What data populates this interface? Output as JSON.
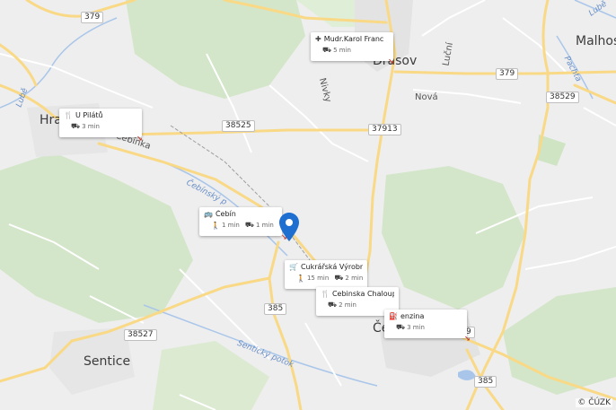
{
  "map": {
    "attribution": "© ČÚZK",
    "places": {
      "dr": "Drásov",
      "hr": "Hra",
      "sentice": "Sentice",
      "malhos": "Malhos",
      "ce": "Če",
      "nivky": "Nivky",
      "lucni": "Luční",
      "nova": "Nová",
      "cebinka": "Čebínka"
    },
    "streams": {
      "cebinsky": "Čebínský p",
      "sentice": "Sentický potok",
      "lube": "Lubě",
      "lube2": "Lubě",
      "pachta": "Pachta"
    },
    "roads": {
      "r379a": "379",
      "r379b": "379",
      "r38525": "38525",
      "r37913": "37913",
      "r38529": "38529",
      "r385a": "385",
      "r385b": "385",
      "r38527": "38527",
      "r9": "9"
    },
    "cards": [
      {
        "title": "Mudr.Karol Franc",
        "icon": "medical-icon",
        "drive": "5 min"
      },
      {
        "title": "U Pilátů",
        "icon": "restaurant-icon",
        "drive": "3 min"
      },
      {
        "title": "Čebín",
        "icon": "bus-icon",
        "walk": "1 min",
        "drive": "1 min"
      },
      {
        "title": "Cukrářská Výrobn...",
        "icon": "shop-icon",
        "walk": "15 min",
        "drive": "2 min"
      },
      {
        "title": "Cebinska Chaloup...",
        "icon": "restaurant-icon",
        "drive": "2 min"
      },
      {
        "title": "enzina",
        "icon": "fuel-icon",
        "drive": "3 min"
      }
    ],
    "colors": {
      "background": "#eeeeee",
      "forest": "#d3e6c9",
      "road_main": "#f9d986",
      "road_minor": "#ffffff",
      "water": "#a9c6ea",
      "pin": "#1f6fd1"
    }
  }
}
